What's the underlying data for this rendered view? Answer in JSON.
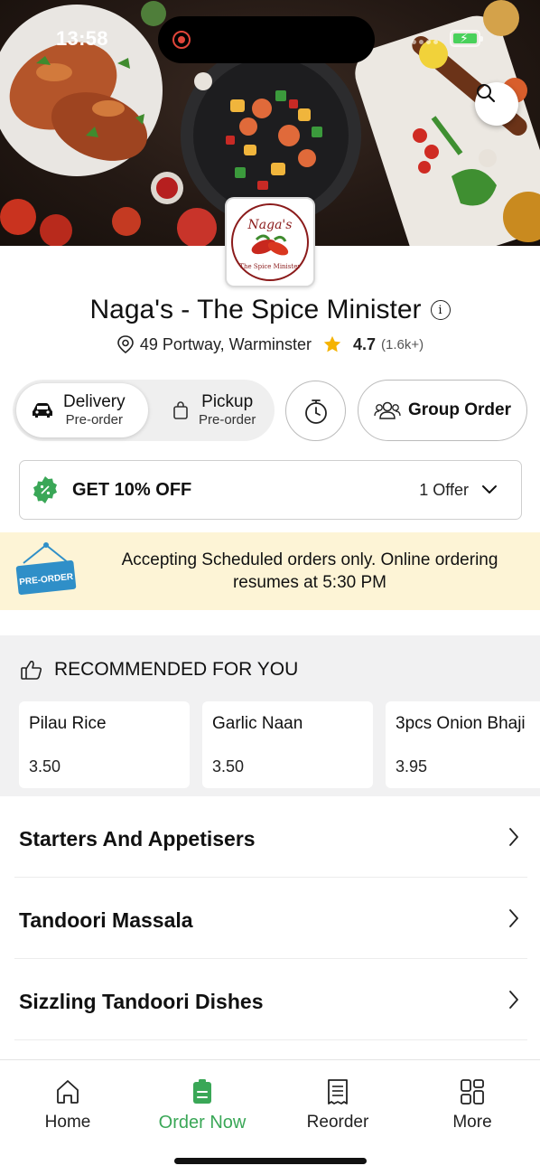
{
  "status_bar": {
    "time": "13:58"
  },
  "restaurant": {
    "name": "Naga's - The Spice Minister",
    "address": "49 Portway, Warminster",
    "rating": "4.7",
    "rating_count": "(1.6k+)",
    "logo_text_top": "Naga's",
    "logo_text_bottom": "The Spice Minister"
  },
  "order_mode": {
    "delivery": {
      "label": "Delivery",
      "sub": "Pre-order",
      "selected": true
    },
    "pickup": {
      "label": "Pickup",
      "sub": "Pre-order",
      "selected": false
    },
    "group_order_label": "Group Order"
  },
  "offer": {
    "title": "GET 10% OFF",
    "count_label": "1 Offer"
  },
  "preorder_banner": {
    "sign_text": "PRE-ORDER",
    "line1": "Accepting Scheduled orders only. Online ordering",
    "line2": "resumes at 5:30 PM"
  },
  "recommended": {
    "title": "RECOMMENDED FOR YOU",
    "items": [
      {
        "name": "Pilau Rice",
        "price": "3.50"
      },
      {
        "name": "Garlic Naan",
        "price": "3.50"
      },
      {
        "name": "3pcs Onion Bhaji",
        "price": "3.95"
      }
    ]
  },
  "categories": [
    {
      "label": "Starters And Appetisers"
    },
    {
      "label": "Tandoori Massala"
    },
    {
      "label": "Sizzling Tandoori Dishes"
    }
  ],
  "bottom_nav": [
    {
      "label": "Home",
      "icon": "home-icon",
      "active": false
    },
    {
      "label": "Order Now",
      "icon": "order-icon",
      "active": true
    },
    {
      "label": "Reorder",
      "icon": "receipt-icon",
      "active": false
    },
    {
      "label": "More",
      "icon": "grid-icon",
      "active": false
    }
  ],
  "colors": {
    "accent_green": "#3aa757",
    "banner_bg": "#fdf4d6",
    "star": "#f5b301",
    "preorder_sign": "#2f8fc8"
  }
}
